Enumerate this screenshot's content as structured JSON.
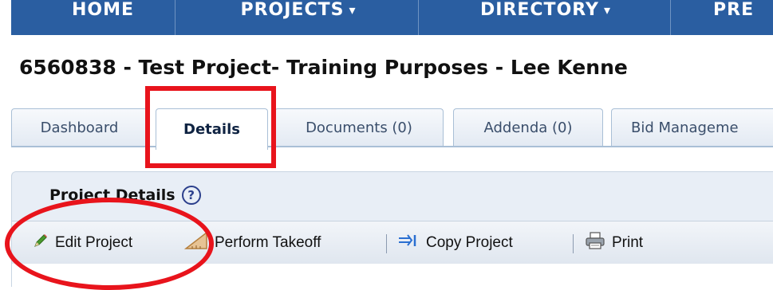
{
  "nav": {
    "items": [
      "HOME",
      "PROJECTS",
      "DIRECTORY",
      "PRE"
    ],
    "dropdown_markers": [
      "",
      "▾",
      "▾",
      ""
    ]
  },
  "project": {
    "title": "6560838 - Test Project- Training Purposes - Lee Kenne"
  },
  "tabs": [
    {
      "label": "Dashboard",
      "active": false
    },
    {
      "label": "Details",
      "active": true
    },
    {
      "label": "Documents (0)",
      "active": false
    },
    {
      "label": "Addenda (0)",
      "active": false
    },
    {
      "label": "Bid Manageme",
      "active": false
    }
  ],
  "panel": {
    "title": "Project Details",
    "help_glyph": "?"
  },
  "toolbar": {
    "edit_label": "Edit Project",
    "takeoff_label": "Perform Takeoff",
    "copy_label": "Copy Project",
    "print_label": "Print"
  },
  "colors": {
    "nav_bg": "#2a5ea1",
    "annotation": "#e8141c",
    "panel_bg": "#e8eef6"
  }
}
